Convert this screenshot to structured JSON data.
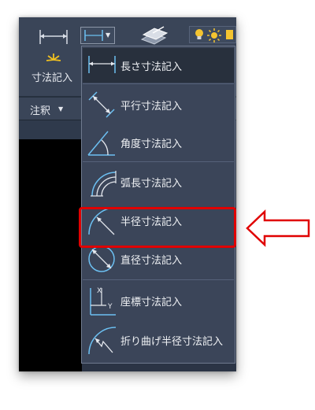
{
  "ribbon": {
    "dimension_button_label": "寸法記入",
    "panel_label": "注釈"
  },
  "menu": {
    "items": [
      {
        "label": "長さ寸法記入",
        "icon": "linear-dimension-icon",
        "active": true
      },
      {
        "label": "平行寸法記入",
        "icon": "aligned-dimension-icon",
        "active": false
      },
      {
        "label": "角度寸法記入",
        "icon": "angular-dimension-icon",
        "active": false
      },
      {
        "label": "弧長寸法記入",
        "icon": "arc-length-dimension-icon",
        "active": false
      },
      {
        "label": "半径寸法記入",
        "icon": "radius-dimension-icon",
        "active": false
      },
      {
        "label": "直径寸法記入",
        "icon": "diameter-dimension-icon",
        "active": false
      },
      {
        "label": "座標寸法記入",
        "icon": "ordinate-dimension-icon",
        "active": false
      },
      {
        "label": "折り曲げ半径寸法記入",
        "icon": "jogged-radius-dimension-icon",
        "active": false
      }
    ]
  },
  "colors": {
    "accent": "#5db8f0",
    "highlight": "#e00000",
    "menu_bg": "#3b4559"
  }
}
